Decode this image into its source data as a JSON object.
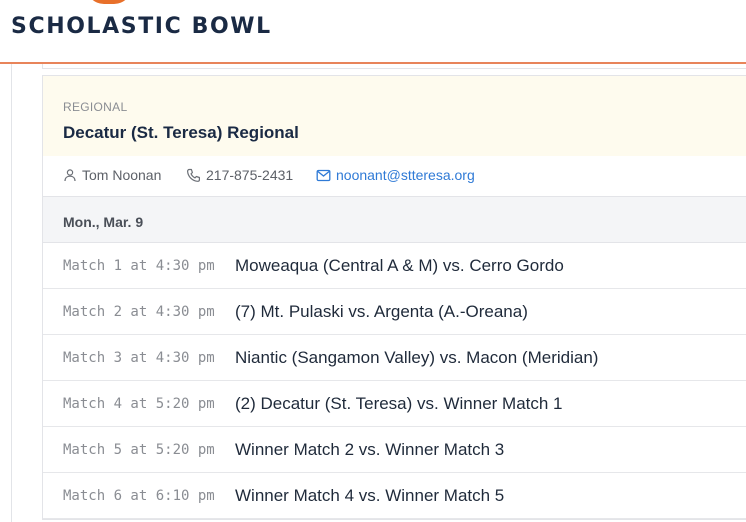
{
  "header": {
    "site_title": "SCHOLASTIC BOWL"
  },
  "card": {
    "type_label": "REGIONAL",
    "title": "Decatur (St. Teresa) Regional",
    "contact": {
      "name": "Tom Noonan",
      "phone": "217-875-2431",
      "email": "noonant@stteresa.org"
    },
    "date": "Mon., Mar. 9",
    "matches": [
      {
        "time": "Match 1 at 4:30 pm",
        "name": "Moweaqua (Central A & M) vs. Cerro Gordo"
      },
      {
        "time": "Match 2 at 4:30 pm",
        "name": "(7) Mt. Pulaski vs. Argenta (A.-Oreana)"
      },
      {
        "time": "Match 3 at 4:30 pm",
        "name": "Niantic (Sangamon Valley) vs. Macon (Meridian)"
      },
      {
        "time": "Match 4 at 5:20 pm",
        "name": "(2) Decatur (St. Teresa) vs. Winner Match 1"
      },
      {
        "time": "Match 5 at 5:20 pm",
        "name": "Winner Match 2 vs. Winner Match 3"
      },
      {
        "time": "Match 6 at 6:10 pm",
        "name": "Winner Match 4 vs. Winner Match 5"
      }
    ]
  },
  "colors": {
    "accent": "#e8702a",
    "title": "#1a2a44",
    "link": "#2f7ad6",
    "card_header_bg": "#fefbee"
  }
}
